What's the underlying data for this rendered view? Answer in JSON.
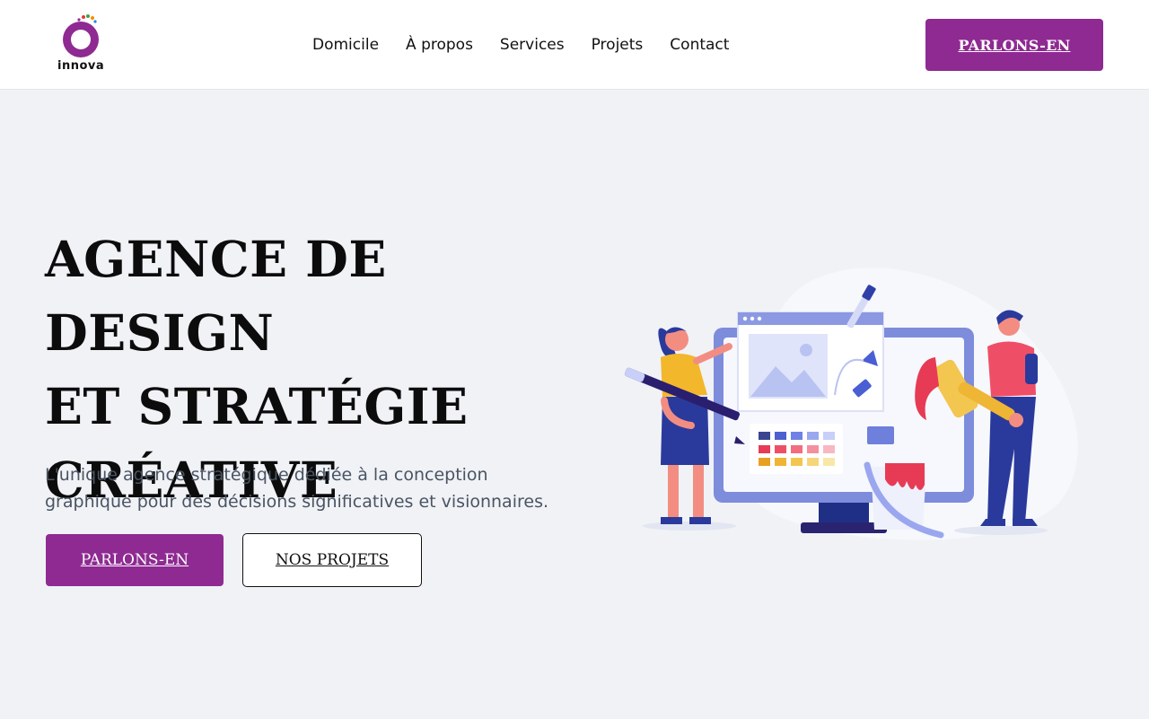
{
  "header": {
    "logo_text": "innova",
    "nav": [
      "Domicile",
      "À propos",
      "Services",
      "Projets",
      "Contact"
    ],
    "cta_label": "PARLONS-EN"
  },
  "hero": {
    "title_lines": [
      "AGENCE DE DESIGN",
      "ET STRATÉGIE",
      "CRÉATIVE"
    ],
    "subtitle": "L'unique agence stratégique dédiée à la conception graphique pour des décisions significatives et visionnaires.",
    "primary_button": "PARLONS-EN",
    "secondary_button": "NOS PROJETS"
  },
  "colors": {
    "brand": "#8e2a92",
    "background": "#f0f2f6",
    "text": "#0c0c0c"
  },
  "icons": [
    "innova-logo",
    "design-team-illustration"
  ]
}
